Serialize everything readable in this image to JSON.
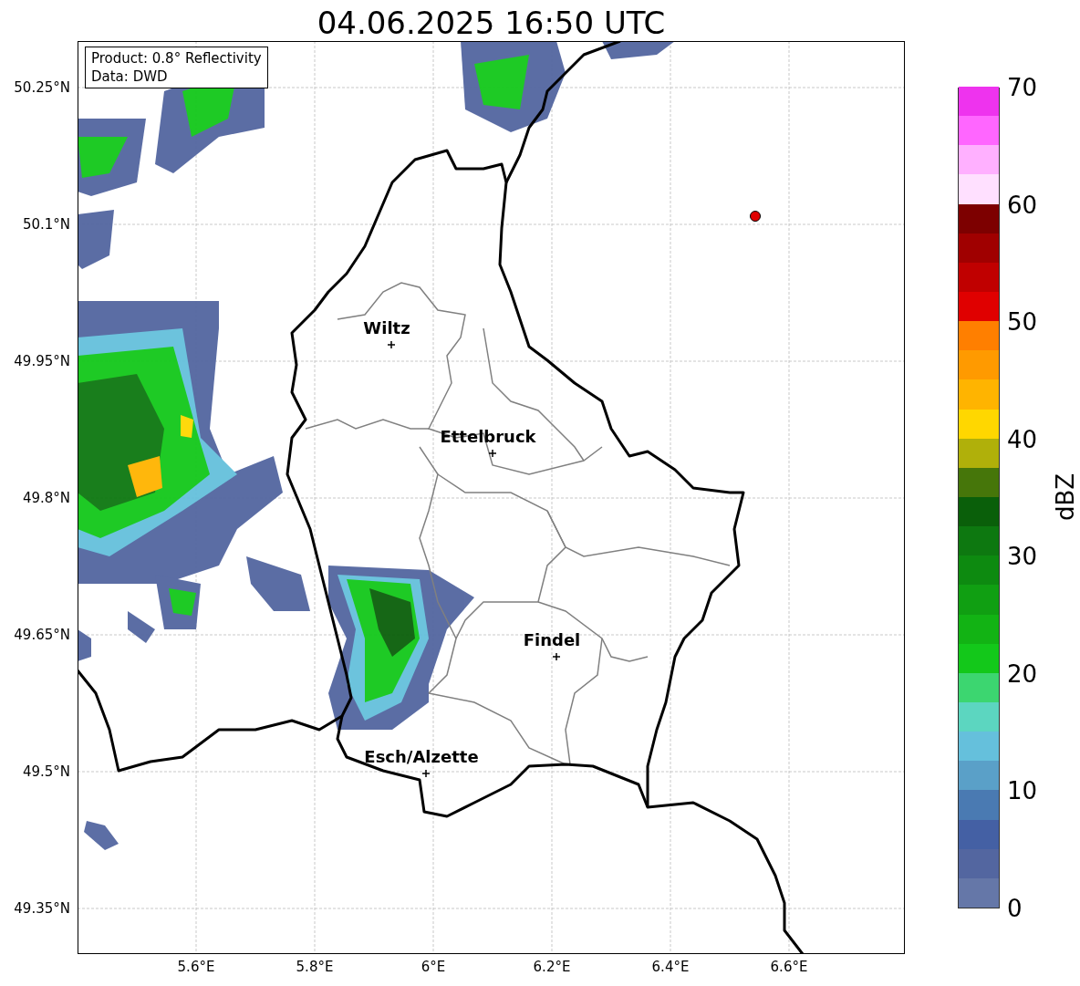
{
  "title": "04.06.2025 16:50 UTC",
  "info_box": [
    "Product: 0.8° Reflectivity",
    "Data: DWD"
  ],
  "lat_ticks": [
    "50.25°N",
    "50.1°N",
    "49.95°N",
    "49.8°N",
    "49.65°N",
    "49.5°N",
    "49.35°N"
  ],
  "lon_ticks": [
    "5.6°E",
    "5.8°E",
    "6°E",
    "6.2°E",
    "6.4°E",
    "6.6°E"
  ],
  "cities": [
    {
      "name": "Wiltz"
    },
    {
      "name": "Ettelbruck"
    },
    {
      "name": "Findel"
    },
    {
      "name": "Esch/Alzette"
    }
  ],
  "colorbar": {
    "label": "dBZ",
    "ticks": [
      "70",
      "60",
      "50",
      "40",
      "30",
      "20",
      "10",
      "0"
    ],
    "bins": [
      {
        "color": "#6577a8"
      },
      {
        "color": "#5366a0"
      },
      {
        "color": "#4460a4"
      },
      {
        "color": "#4a7ab2"
      },
      {
        "color": "#5aa0c8"
      },
      {
        "color": "#65c0dc"
      },
      {
        "color": "#5cd6c0"
      },
      {
        "color": "#3cd670"
      },
      {
        "color": "#13c81a"
      },
      {
        "color": "#12b314"
      },
      {
        "color": "#109f12"
      },
      {
        "color": "#0d8a10"
      },
      {
        "color": "#0d7810"
      },
      {
        "color": "#0a5f0a"
      },
      {
        "color": "#46760a"
      },
      {
        "color": "#b0b00a"
      },
      {
        "color": "#ffd700"
      },
      {
        "color": "#ffb400"
      },
      {
        "color": "#ff9a00"
      },
      {
        "color": "#ff7f00"
      },
      {
        "color": "#e00000"
      },
      {
        "color": "#c00000"
      },
      {
        "color": "#a00000"
      },
      {
        "color": "#7d0000"
      },
      {
        "color": "#ffe0ff"
      },
      {
        "color": "#ffb0ff"
      },
      {
        "color": "#ff66ff"
      },
      {
        "color": "#ee33ee"
      }
    ]
  }
}
